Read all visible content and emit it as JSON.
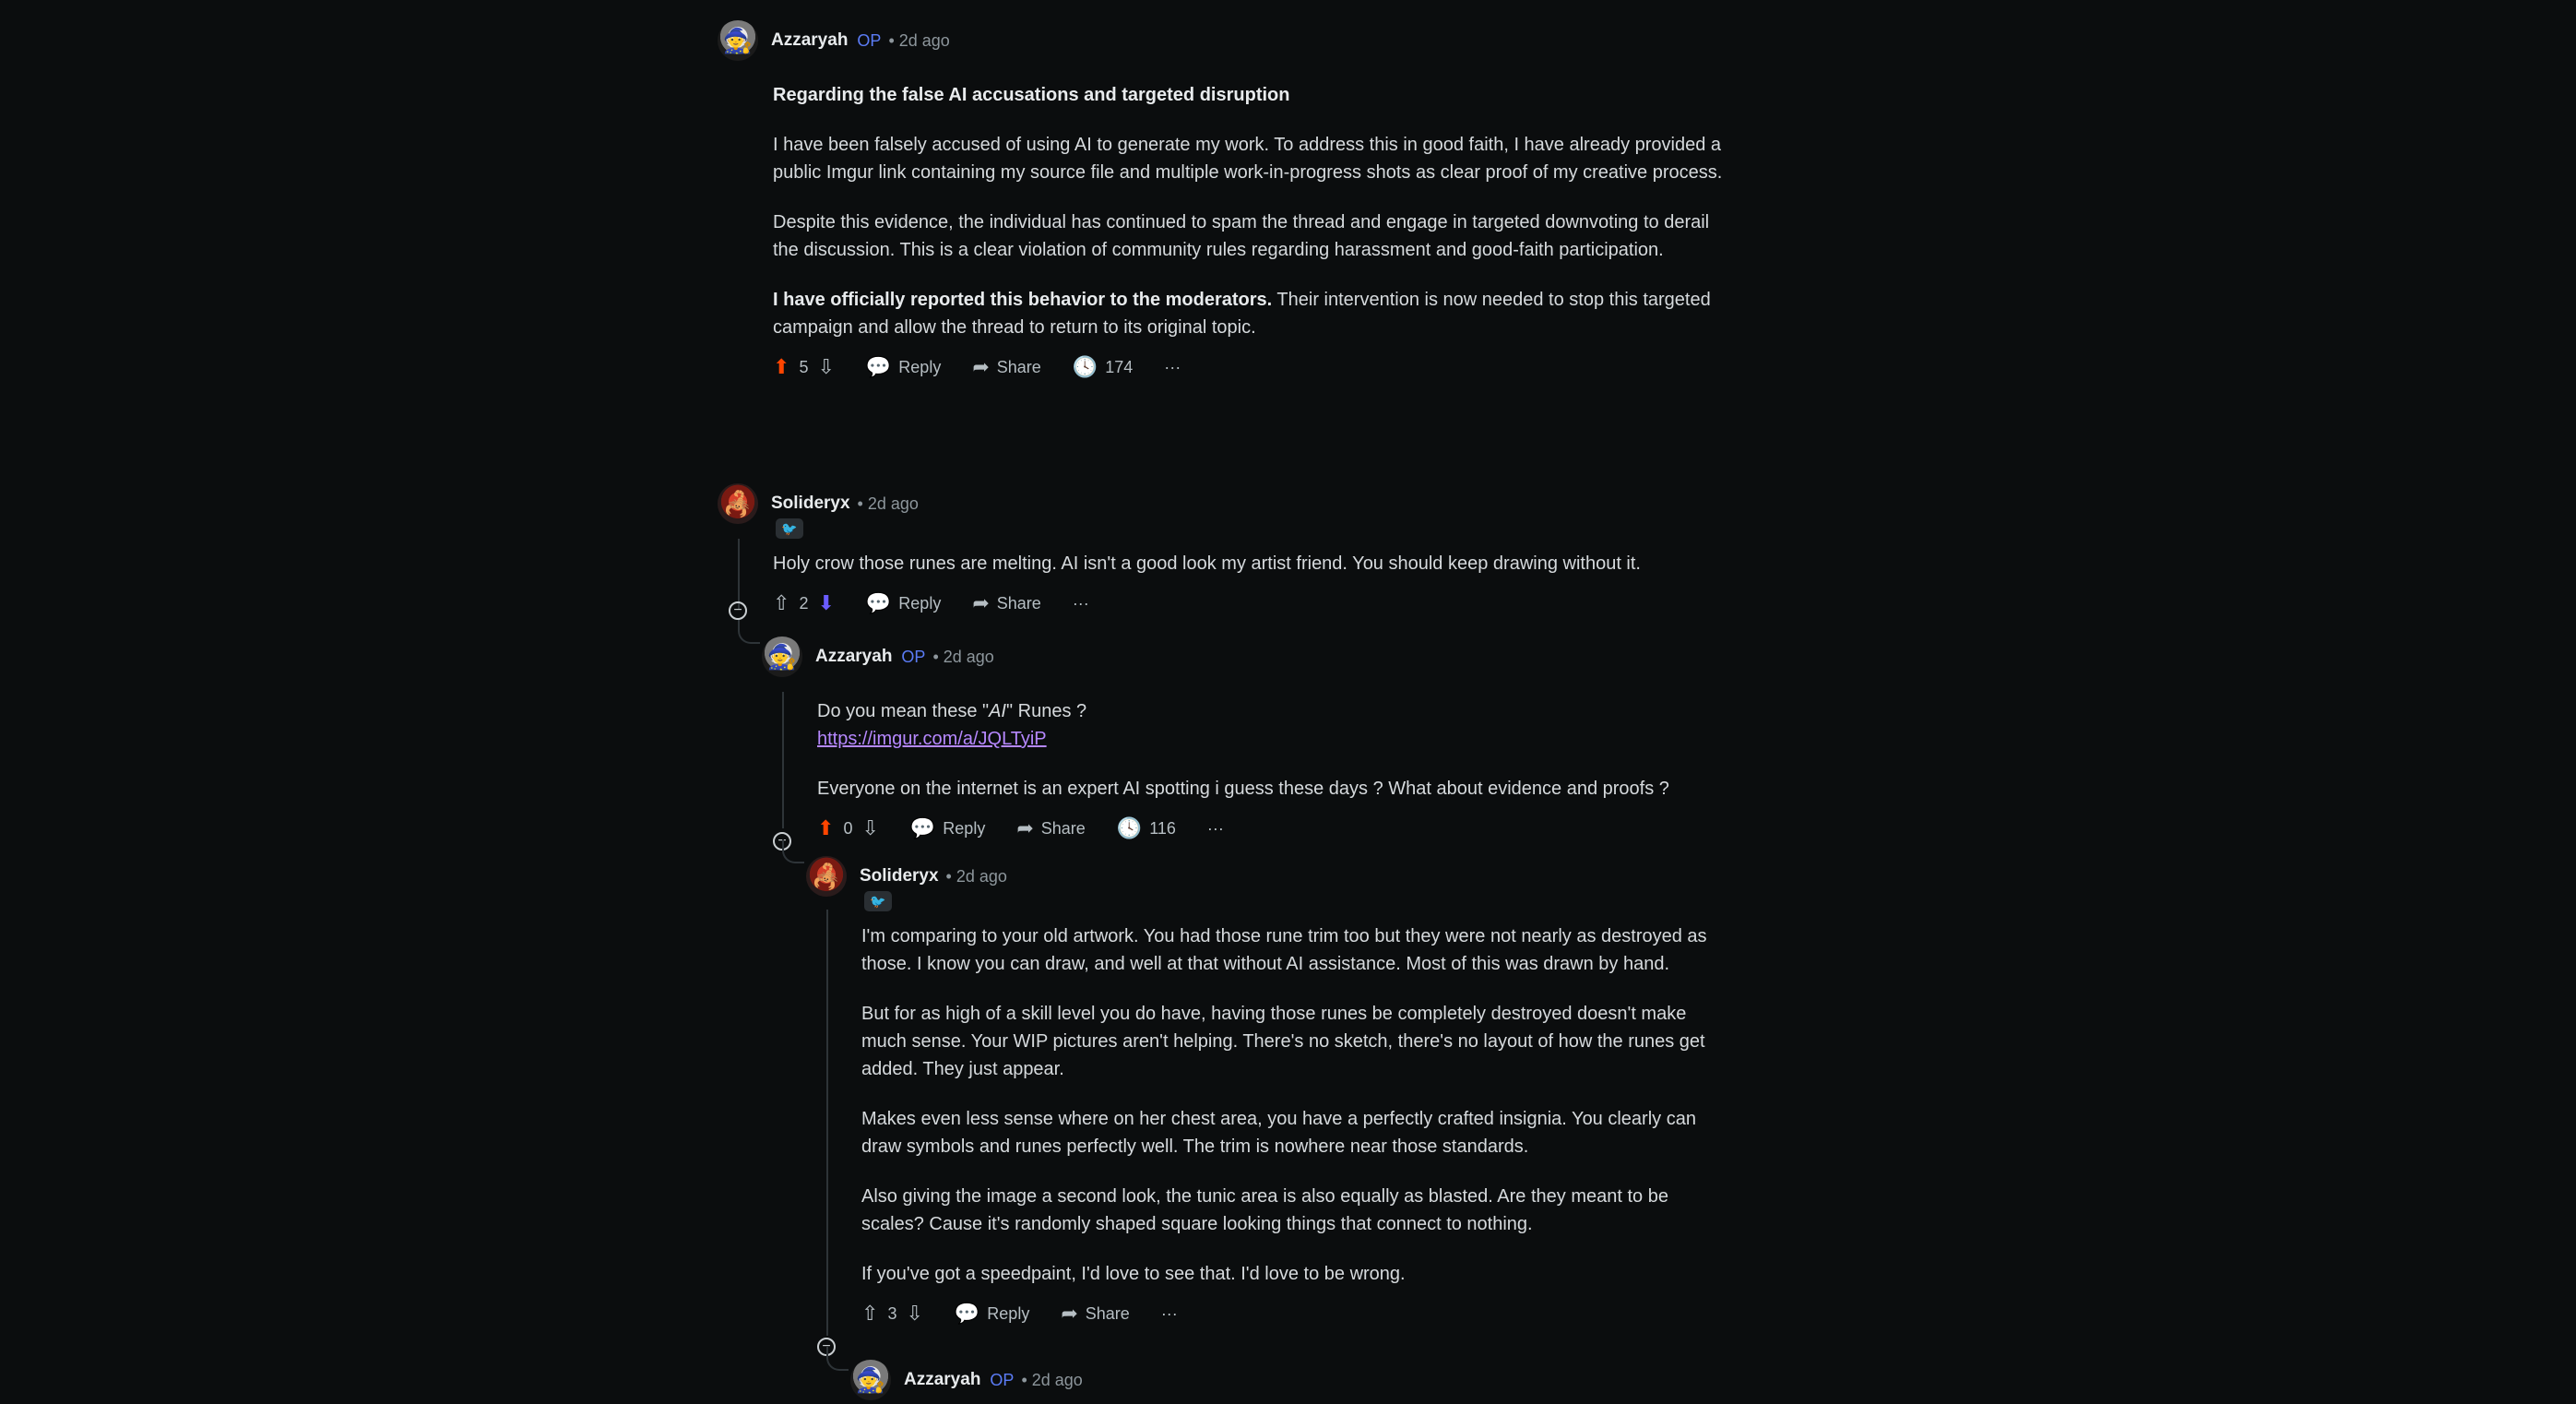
{
  "comments": {
    "c1": {
      "author": "Azzaryah",
      "op": "OP",
      "time": "• 2d ago",
      "title": "Regarding the false AI accusations and targeted disruption",
      "p1": "I have been falsely accused of using AI to generate my work. To address this in good faith, I have already provided a public Imgur link containing my source file and multiple work-in-progress shots as clear proof of my creative process.",
      "p2": "Despite this evidence, the individual has continued to spam the thread and engage in targeted downvoting to derail the discussion. This is a clear violation of community rules regarding harassment and good-faith participation.",
      "p3_bold": "I have officially reported this behavior to the moderators.",
      "p3_rest": " Their intervention is now needed to stop this targeted campaign and allow the thread to return to its original topic.",
      "votes": "5",
      "reply": "Reply",
      "share": "Share",
      "views": "174",
      "more": "···"
    },
    "c2": {
      "author": "Solideryx",
      "time": "• 2d ago",
      "p1": "Holy crow those runes are melting. AI isn't a good look my artist friend. You should keep drawing without it.",
      "votes": "2",
      "reply": "Reply",
      "share": "Share",
      "more": "···"
    },
    "c3": {
      "author": "Azzaryah",
      "op": "OP",
      "time": "• 2d ago",
      "p1_pre": "Do you mean these \"",
      "p1_em": "AI",
      "p1_post": "\" Runes ?",
      "link": "https://imgur.com/a/JQLTyiP",
      "p2": "Everyone on the internet is an expert AI spotting i guess these days ? What about evidence and proofs ?",
      "votes": "0",
      "reply": "Reply",
      "share": "Share",
      "views": "116",
      "more": "···"
    },
    "c4": {
      "author": "Solideryx",
      "time": "• 2d ago",
      "p1": "I'm comparing to your old artwork. You had those rune trim too but they were not nearly as destroyed as those. I know you can draw, and well at that without AI assistance. Most of this was drawn by hand.",
      "p2": "But for as high of a skill level you do have, having those runes be completely destroyed doesn't make much sense. Your WIP pictures aren't helping. There's no sketch, there's no layout of how the runes get added. They just appear.",
      "p3": "Makes even less sense where on her chest area, you have a perfectly crafted insignia. You clearly can draw symbols and runes perfectly well. The trim is nowhere near those standards.",
      "p4": "Also giving the image a second look, the tunic area is also equally as blasted. Are they meant to be scales? Cause it's randomly shaped square looking things that connect to nothing.",
      "p5": "If you've got a speedpaint, I'd love to see that. I'd love to be wrong.",
      "votes": "3",
      "reply": "Reply",
      "share": "Share",
      "more": "···"
    },
    "c5": {
      "author": "Azzaryah",
      "op": "OP",
      "time": "• 2d ago"
    }
  },
  "icons": {
    "upvote": "upvote-icon",
    "downvote": "downvote-icon",
    "reply": "comment-bubble-icon",
    "share": "share-arrow-icon",
    "views": "clock-icon",
    "collapse": "collapse-minus-icon"
  },
  "colors": {
    "background": "#0b0d0e",
    "upvote_active": "#ff4500",
    "downvote_active": "#6a5cff",
    "op": "#5b7cf6",
    "link": "#b688ff"
  }
}
